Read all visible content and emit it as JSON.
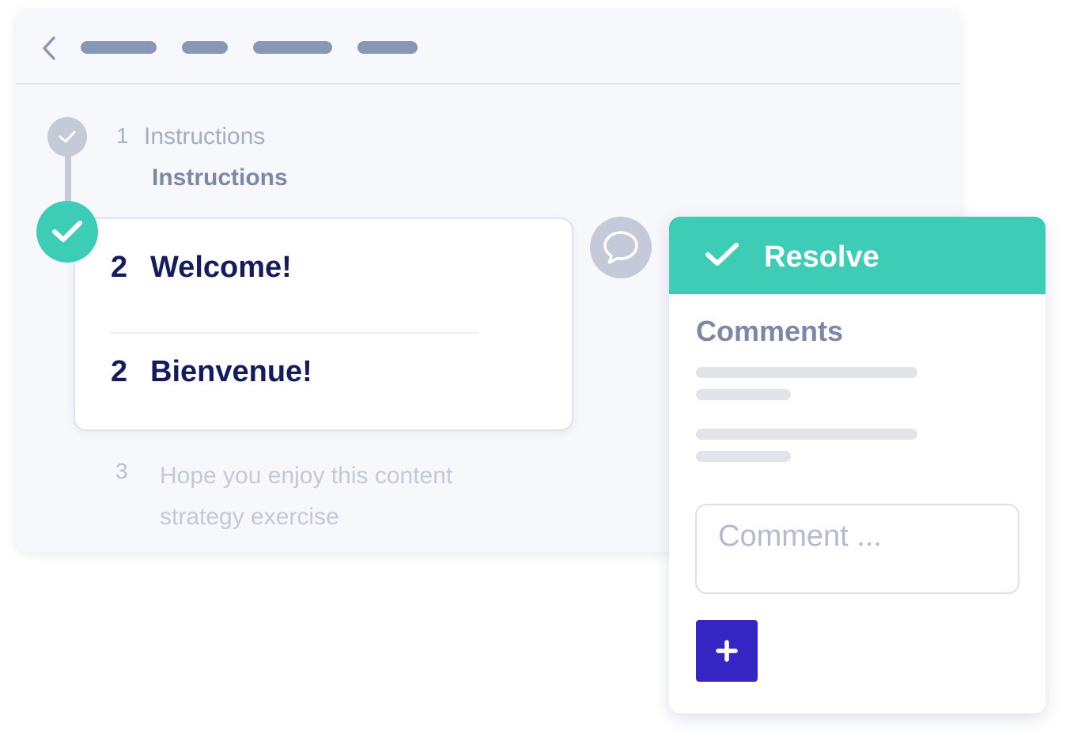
{
  "steps": [
    {
      "number": "1",
      "title": "Instructions",
      "subtitle": "Instructions",
      "status": "completed"
    },
    {
      "number": "2",
      "source_text": "Welcome!",
      "translation": "Bienvenue!",
      "status": "active"
    },
    {
      "number": "3",
      "text": "Hope you enjoy this content strategy exercise",
      "status": "upcoming"
    }
  ],
  "comments_panel": {
    "resolve_label": "Resolve",
    "title": "Comments",
    "input_placeholder": "Comment ...",
    "input_value": ""
  },
  "icons": {
    "back": "chevron-left-icon",
    "step_done": "check-icon",
    "comment": "speech-bubble-icon",
    "resolve": "check-icon",
    "add": "plus-icon"
  },
  "colors": {
    "accent_teal": "#3dcdb7",
    "add_button": "#3525c2",
    "heading_text": "#141c5e",
    "muted_text": "#7d88a6",
    "breadcrumb_placeholder": "#8a96b5"
  }
}
